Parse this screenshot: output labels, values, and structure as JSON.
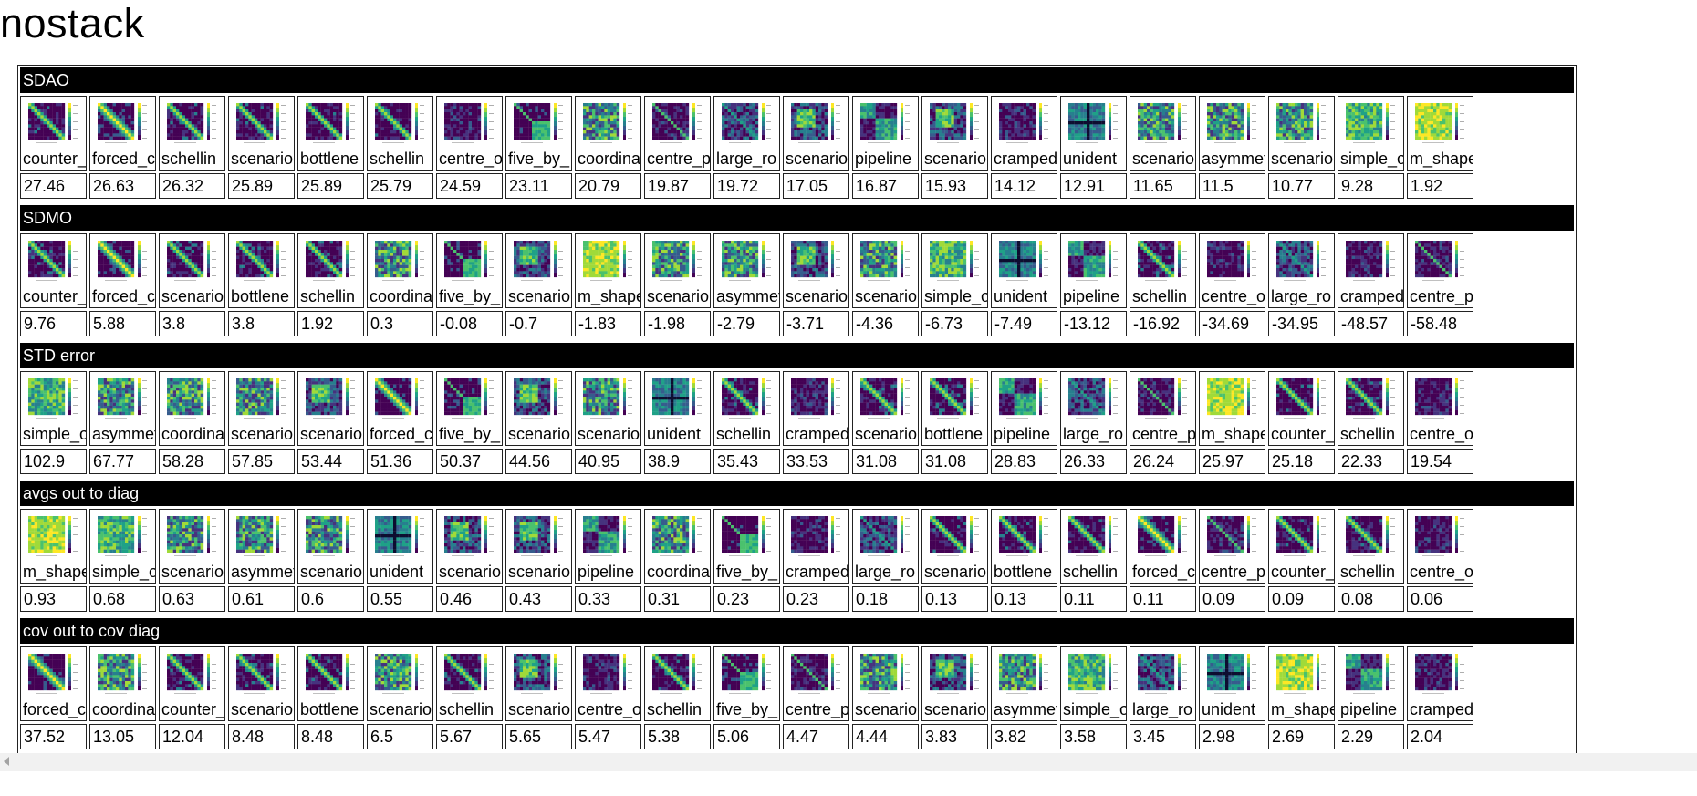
{
  "page": {
    "title": "nostack"
  },
  "sections": [
    {
      "header": "SDAO",
      "items": [
        {
          "label": "counter_",
          "value": "27.46",
          "thumb": "purple-diag"
        },
        {
          "label": "forced_c",
          "value": "26.63",
          "thumb": "forced-diag"
        },
        {
          "label": "schellin",
          "value": "26.32",
          "thumb": "purple-diag"
        },
        {
          "label": "scenario",
          "value": "25.89",
          "thumb": "purple-diag"
        },
        {
          "label": "bottlene",
          "value": "25.89",
          "thumb": "purple-diag"
        },
        {
          "label": "schellin",
          "value": "25.79",
          "thumb": "purple-diag"
        },
        {
          "label": "centre_o",
          "value": "24.59",
          "thumb": "dark"
        },
        {
          "label": "five_by_",
          "value": "23.11",
          "thumb": "block-br"
        },
        {
          "label": "coordina",
          "value": "20.79",
          "thumb": "green-noisy"
        },
        {
          "label": "centre_p",
          "value": "19.87",
          "thumb": "dark-diag"
        },
        {
          "label": "large_ro",
          "value": "19.72",
          "thumb": "blue-noisy"
        },
        {
          "label": "scenario",
          "value": "17.05",
          "thumb": "green-block"
        },
        {
          "label": "pipeline",
          "value": "16.87",
          "thumb": "teal-blocks"
        },
        {
          "label": "scenario",
          "value": "15.93",
          "thumb": "green-block"
        },
        {
          "label": "cramped_",
          "value": "14.12",
          "thumb": "dark"
        },
        {
          "label": "unident",
          "value": "12.91",
          "thumb": "cross"
        },
        {
          "label": "scenario",
          "value": "11.65",
          "thumb": "green-noisy"
        },
        {
          "label": "asymmetr",
          "value": "11.5",
          "thumb": "green-noisy"
        },
        {
          "label": "scenario",
          "value": "10.77",
          "thumb": "green-noisy"
        },
        {
          "label": "simple_o",
          "value": "9.28",
          "thumb": "green-light"
        },
        {
          "label": "m_shaped",
          "value": "1.92",
          "thumb": "yellow"
        }
      ]
    },
    {
      "header": "SDMO",
      "items": [
        {
          "label": "counter_",
          "value": "9.76",
          "thumb": "purple-diag"
        },
        {
          "label": "forced_c",
          "value": "5.88",
          "thumb": "forced-diag"
        },
        {
          "label": "scenario",
          "value": "3.8",
          "thumb": "purple-diag"
        },
        {
          "label": "bottlene",
          "value": "3.8",
          "thumb": "purple-diag"
        },
        {
          "label": "schellin",
          "value": "1.92",
          "thumb": "purple-diag"
        },
        {
          "label": "coordina",
          "value": "0.3",
          "thumb": "green-noisy"
        },
        {
          "label": "five_by_",
          "value": "-0.08",
          "thumb": "block-br"
        },
        {
          "label": "scenario",
          "value": "-0.7",
          "thumb": "green-block"
        },
        {
          "label": "m_shaped",
          "value": "-1.83",
          "thumb": "yellow"
        },
        {
          "label": "scenario",
          "value": "-1.98",
          "thumb": "green-noisy"
        },
        {
          "label": "asymmetr",
          "value": "-2.79",
          "thumb": "green-noisy"
        },
        {
          "label": "scenario",
          "value": "-3.71",
          "thumb": "green-block"
        },
        {
          "label": "scenario",
          "value": "-4.36",
          "thumb": "green-noisy"
        },
        {
          "label": "simple_o",
          "value": "-6.73",
          "thumb": "green-light"
        },
        {
          "label": "unident",
          "value": "-7.49",
          "thumb": "cross"
        },
        {
          "label": "pipeline",
          "value": "-13.12",
          "thumb": "teal-blocks"
        },
        {
          "label": "schellin",
          "value": "-16.92",
          "thumb": "purple-diag"
        },
        {
          "label": "centre_o",
          "value": "-34.69",
          "thumb": "dark"
        },
        {
          "label": "large_ro",
          "value": "-34.95",
          "thumb": "blue-noisy"
        },
        {
          "label": "cramped_",
          "value": "-48.57",
          "thumb": "dark"
        },
        {
          "label": "centre_p",
          "value": "-58.48",
          "thumb": "dark-diag"
        }
      ]
    },
    {
      "header": "STD error",
      "items": [
        {
          "label": "simple_o",
          "value": "102.9",
          "thumb": "green-light"
        },
        {
          "label": "asymmetr",
          "value": "67.77",
          "thumb": "green-noisy"
        },
        {
          "label": "coordina",
          "value": "58.28",
          "thumb": "green-noisy"
        },
        {
          "label": "scenario",
          "value": "57.85",
          "thumb": "green-noisy"
        },
        {
          "label": "scenario",
          "value": "53.44",
          "thumb": "green-block"
        },
        {
          "label": "forced_c",
          "value": "51.36",
          "thumb": "forced-diag"
        },
        {
          "label": "five_by_",
          "value": "50.37",
          "thumb": "block-br"
        },
        {
          "label": "scenario",
          "value": "44.56",
          "thumb": "green-block"
        },
        {
          "label": "scenario",
          "value": "40.95",
          "thumb": "green-noisy"
        },
        {
          "label": "unident",
          "value": "38.9",
          "thumb": "cross"
        },
        {
          "label": "schellin",
          "value": "35.43",
          "thumb": "purple-diag"
        },
        {
          "label": "cramped_",
          "value": "33.53",
          "thumb": "dark"
        },
        {
          "label": "scenario",
          "value": "31.08",
          "thumb": "purple-diag"
        },
        {
          "label": "bottlene",
          "value": "31.08",
          "thumb": "purple-diag"
        },
        {
          "label": "pipeline",
          "value": "28.83",
          "thumb": "teal-blocks"
        },
        {
          "label": "large_ro",
          "value": "26.33",
          "thumb": "blue-noisy"
        },
        {
          "label": "centre_p",
          "value": "26.24",
          "thumb": "dark-diag"
        },
        {
          "label": "m_shaped",
          "value": "25.97",
          "thumb": "yellow"
        },
        {
          "label": "counter_",
          "value": "25.18",
          "thumb": "purple-diag"
        },
        {
          "label": "schellin",
          "value": "22.33",
          "thumb": "purple-diag"
        },
        {
          "label": "centre_o",
          "value": "19.54",
          "thumb": "dark"
        }
      ]
    },
    {
      "header": "avgs out to diag",
      "items": [
        {
          "label": "m_shaped",
          "value": "0.93",
          "thumb": "yellow"
        },
        {
          "label": "simple_o",
          "value": "0.68",
          "thumb": "green-light"
        },
        {
          "label": "scenario",
          "value": "0.63",
          "thumb": "green-noisy"
        },
        {
          "label": "asymmetr",
          "value": "0.61",
          "thumb": "green-noisy"
        },
        {
          "label": "scenario",
          "value": "0.6",
          "thumb": "green-noisy"
        },
        {
          "label": "unident",
          "value": "0.55",
          "thumb": "cross"
        },
        {
          "label": "scenario",
          "value": "0.46",
          "thumb": "green-block"
        },
        {
          "label": "scenario",
          "value": "0.43",
          "thumb": "green-block"
        },
        {
          "label": "pipeline",
          "value": "0.33",
          "thumb": "teal-blocks"
        },
        {
          "label": "coordina",
          "value": "0.31",
          "thumb": "green-noisy"
        },
        {
          "label": "five_by_",
          "value": "0.23",
          "thumb": "block-br"
        },
        {
          "label": "cramped_",
          "value": "0.23",
          "thumb": "dark"
        },
        {
          "label": "large_ro",
          "value": "0.18",
          "thumb": "blue-noisy"
        },
        {
          "label": "scenario",
          "value": "0.13",
          "thumb": "purple-diag"
        },
        {
          "label": "bottlene",
          "value": "0.13",
          "thumb": "purple-diag"
        },
        {
          "label": "schellin",
          "value": "0.11",
          "thumb": "purple-diag"
        },
        {
          "label": "forced_c",
          "value": "0.11",
          "thumb": "forced-diag"
        },
        {
          "label": "centre_p",
          "value": "0.09",
          "thumb": "dark-diag"
        },
        {
          "label": "counter_",
          "value": "0.09",
          "thumb": "purple-diag"
        },
        {
          "label": "schellin",
          "value": "0.08",
          "thumb": "purple-diag"
        },
        {
          "label": "centre_o",
          "value": "0.06",
          "thumb": "dark"
        }
      ]
    },
    {
      "header": "cov out to cov diag",
      "items": [
        {
          "label": "forced_c",
          "value": "37.52",
          "thumb": "forced-diag"
        },
        {
          "label": "coordina",
          "value": "13.05",
          "thumb": "green-noisy"
        },
        {
          "label": "counter_",
          "value": "12.04",
          "thumb": "purple-diag"
        },
        {
          "label": "scenario",
          "value": "8.48",
          "thumb": "purple-diag"
        },
        {
          "label": "bottlene",
          "value": "8.48",
          "thumb": "purple-diag"
        },
        {
          "label": "scenario",
          "value": "6.5",
          "thumb": "green-noisy"
        },
        {
          "label": "schellin",
          "value": "5.67",
          "thumb": "purple-diag"
        },
        {
          "label": "scenario",
          "value": "5.65",
          "thumb": "green-block"
        },
        {
          "label": "centre_o",
          "value": "5.47",
          "thumb": "dark"
        },
        {
          "label": "schellin",
          "value": "5.38",
          "thumb": "purple-diag"
        },
        {
          "label": "five_by_",
          "value": "5.06",
          "thumb": "block-br"
        },
        {
          "label": "centre_p",
          "value": "4.47",
          "thumb": "dark-diag"
        },
        {
          "label": "scenario",
          "value": "4.44",
          "thumb": "green-noisy"
        },
        {
          "label": "scenario",
          "value": "3.83",
          "thumb": "green-block"
        },
        {
          "label": "asymmetr",
          "value": "3.82",
          "thumb": "green-noisy"
        },
        {
          "label": "simple_o",
          "value": "3.58",
          "thumb": "green-light"
        },
        {
          "label": "large_ro",
          "value": "3.45",
          "thumb": "blue-noisy"
        },
        {
          "label": "unident",
          "value": "2.98",
          "thumb": "cross"
        },
        {
          "label": "m_shaped",
          "value": "2.69",
          "thumb": "yellow"
        },
        {
          "label": "pipeline",
          "value": "2.29",
          "thumb": "teal-blocks"
        },
        {
          "label": "cramped_",
          "value": "2.04",
          "thumb": "dark"
        }
      ]
    }
  ],
  "colors": {
    "section_header_bg": "#000000",
    "section_header_text": "#ffffff",
    "viridis_dark": "#440154",
    "viridis_blue": "#3b528b",
    "viridis_teal": "#21918c",
    "viridis_green": "#5ec962",
    "viridis_yellow": "#fde725"
  }
}
